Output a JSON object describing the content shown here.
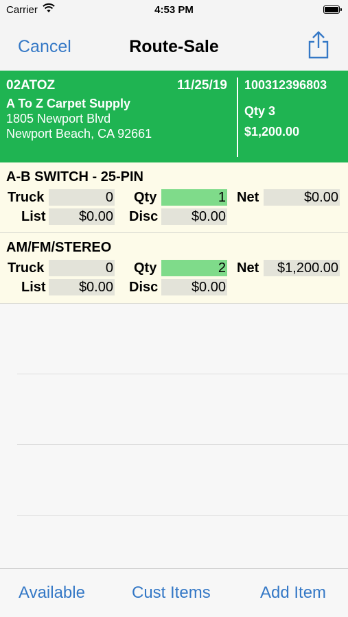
{
  "status": {
    "carrier": "Carrier",
    "time": "4:53 PM"
  },
  "nav": {
    "cancel": "Cancel",
    "title": "Route-Sale"
  },
  "customer": {
    "code": "02ATOZ",
    "date": "11/25/19",
    "name": "A To Z Carpet Supply",
    "address1": "1805 Newport Blvd",
    "address2": "Newport Beach, CA  92661",
    "order_number": "100312396803",
    "qty": "Qty 3",
    "total": "$1,200.00"
  },
  "labels": {
    "truck": "Truck",
    "qty": "Qty",
    "net": "Net",
    "list": "List",
    "disc": "Disc"
  },
  "items": [
    {
      "name": "A-B SWITCH - 25-PIN",
      "truck": "0",
      "qty": "1",
      "net": "$0.00",
      "list": "$0.00",
      "disc": "$0.00"
    },
    {
      "name": "AM/FM/STEREO",
      "truck": "0",
      "qty": "2",
      "net": "$1,200.00",
      "list": "$0.00",
      "disc": "$0.00"
    }
  ],
  "tabs": {
    "available": "Available",
    "cust_items": "Cust Items",
    "add_item": "Add Item"
  },
  "colors": {
    "accent": "#3478c6",
    "header_bg": "#1fb452",
    "qty_bg": "#7fdb8a",
    "row_bg": "#fdfbe9"
  }
}
